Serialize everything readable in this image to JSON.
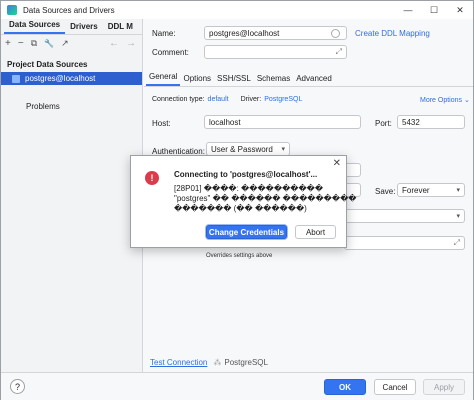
{
  "window": {
    "title": "Data Sources and Drivers",
    "minimize": "—",
    "maximize": "☐",
    "close": "✕"
  },
  "left": {
    "tabs": [
      "Data Sources",
      "Drivers",
      "DDL M"
    ],
    "toolbar": {
      "add": "+",
      "remove": "−",
      "copy": "⧉",
      "settings": "🔧",
      "jump": "↗",
      "back": "←",
      "forward": "→"
    },
    "section_title": "Project Data Sources",
    "datasource": "postgres@localhost",
    "problems": "Problems"
  },
  "right": {
    "name_label": "Name:",
    "name_value": "postgres@localhost",
    "ddl_link": "Create DDL Mapping",
    "comment_label": "Comment:",
    "expand_glyph": "⤢",
    "tabs": [
      "General",
      "Options",
      "SSH/SSL",
      "Schemas",
      "Advanced"
    ],
    "connection_type_label": "Connection type:",
    "connection_type_value": "default",
    "driver_label": "Driver:",
    "driver_value": "PostgreSQL",
    "more_options": "More Options",
    "host_label": "Host:",
    "host_value": "localhost",
    "port_label": "Port:",
    "port_value": "5432",
    "auth_label": "Authentication:",
    "auth_value": "User & Password",
    "save_label": "Save:",
    "save_value": "Forever",
    "overrides_text": "Overrides settings above",
    "test_connection": "Test Connection",
    "test_driver": "PostgreSQL"
  },
  "dialog": {
    "title": "Connecting to 'postgres@localhost'...",
    "message_lines": [
      "[28P01] ����: ����������",
      "\"postgres\" �� ������ ���������",
      "������� (�� ������)"
    ],
    "primary_button": "Change Credentials",
    "secondary_button": "Abort",
    "close": "✕",
    "icon_glyph": "!"
  },
  "bottom": {
    "help": "?",
    "ok": "OK",
    "cancel": "Cancel",
    "apply": "Apply"
  },
  "colors": {
    "accent": "#3574f0",
    "error": "#db3b4b",
    "selection": "#2d5fcf",
    "link": "#2f6fe0"
  }
}
